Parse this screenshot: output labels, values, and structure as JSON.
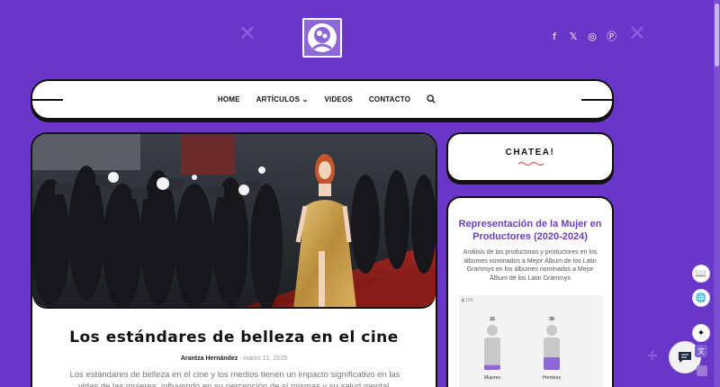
{
  "site": {
    "logo_alt": "Perspectivas logo"
  },
  "decor": {
    "cross": "✕",
    "plus": "+"
  },
  "social": [
    {
      "icon": "facebook-icon",
      "glyph": "f"
    },
    {
      "icon": "x-icon",
      "glyph": "𝕏"
    },
    {
      "icon": "instagram-icon",
      "glyph": "◎"
    },
    {
      "icon": "pinterest-icon",
      "glyph": "Ⓟ"
    }
  ],
  "nav": {
    "items": [
      "HOME",
      "ARTÍCULOS",
      "VIDEOS",
      "CONTACTO"
    ],
    "dropdown_glyph": "⌄"
  },
  "article": {
    "title": "Los estándares de belleza en el cine",
    "author": "Arantza Hernández",
    "separator": " - ",
    "date": "marzo 21, 2025",
    "excerpt": "Los estándares de belleza en el cine  y los medios tienen un impacto significativo en las vidas de las mujeres, influyendo en su percepción de sí mismas y su salud mental. Impactos"
  },
  "chat": {
    "title": "CHATEA!"
  },
  "widget": {
    "title": "Representación de la Mujer en Productores (2020-2024)",
    "description": "Análisis de las productoras y productores en los álbumes nominados a Mejor Álbum de los Latin Grammys en los álbumes nominados a Mejor Álbum de los Latin Grammys",
    "axis_label": "100"
  },
  "chart_data": {
    "type": "bar",
    "categories": [
      "Mujeres",
      "Hombres"
    ],
    "values": [
      15,
      39
    ],
    "ylim": [
      0,
      100
    ],
    "colors": {
      "bar": "#8e67d6",
      "figure": "#c8c8c8"
    }
  },
  "floating": {
    "book": "📖",
    "globe": "🌐",
    "sparkle": "✦",
    "translate": "文"
  }
}
